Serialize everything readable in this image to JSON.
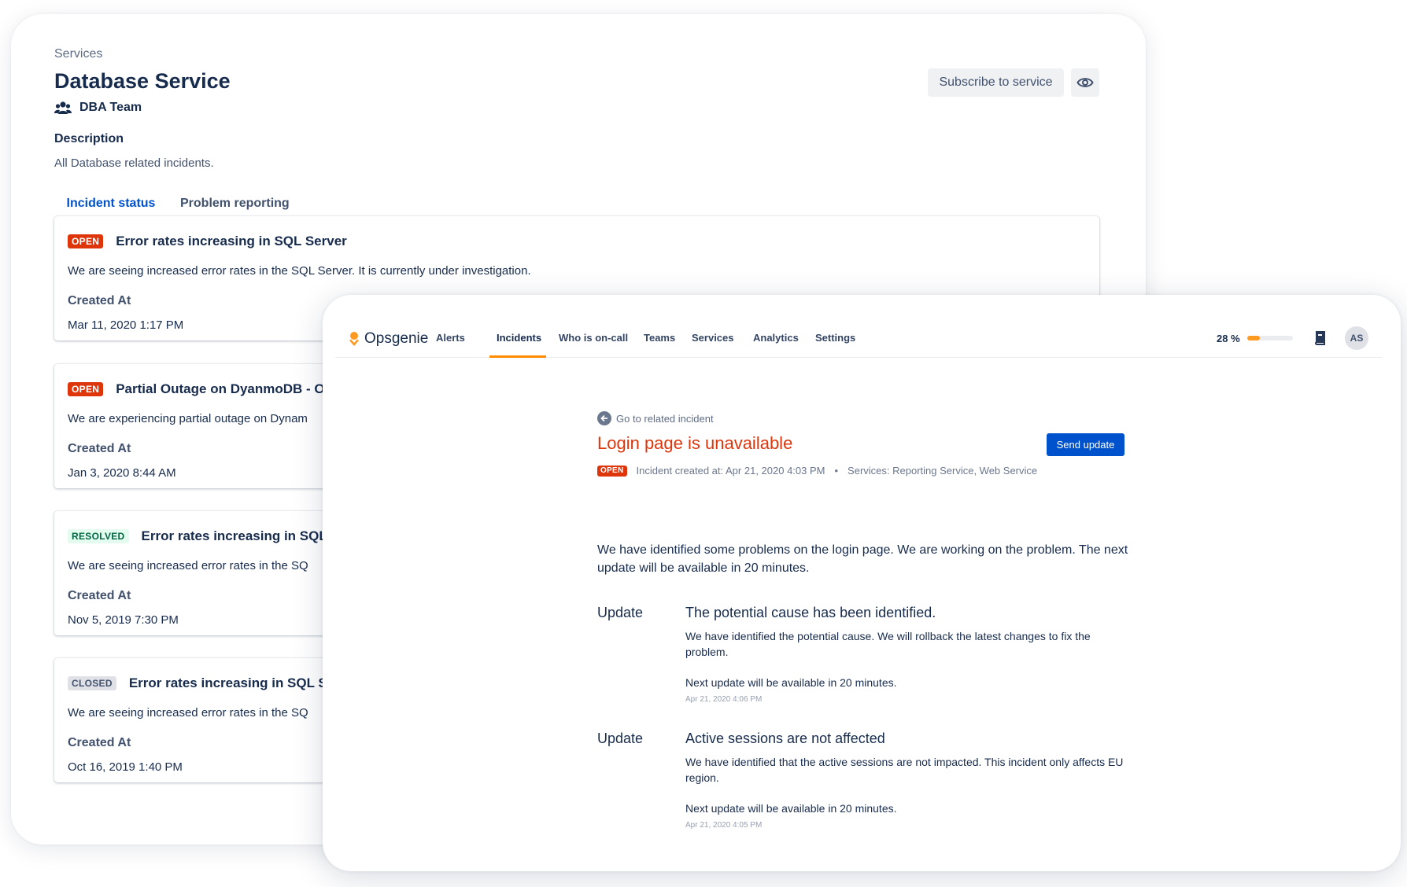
{
  "services_page": {
    "breadcrumb": "Services",
    "title": "Database Service",
    "team": "DBA Team",
    "description_label": "Description",
    "description_text": "All Database related incidents.",
    "subscribe_label": "Subscribe to service",
    "tabs": [
      {
        "label": "Incident status",
        "active": true
      },
      {
        "label": "Problem reporting",
        "active": false
      }
    ],
    "created_at_label": "Created At",
    "incidents": [
      {
        "status": "OPEN",
        "title": "Error rates increasing in SQL Server",
        "body": "We are seeing increased error rates in the SQL Server. It is currently under investigation.",
        "created_at": "Mar 11, 2020 1:17 PM"
      },
      {
        "status": "OPEN",
        "title": "Partial Outage on DyanmoDB - Oh",
        "body": "We are experiencing partial outage on Dynam",
        "created_at": "Jan 3, 2020 8:44 AM"
      },
      {
        "status": "RESOLVED",
        "title": "Error rates increasing in SQL S",
        "body": "We are seeing increased error rates in the SQ",
        "created_at": "Nov 5, 2019 7:30 PM"
      },
      {
        "status": "CLOSED",
        "title": "Error rates increasing in SQL Se",
        "body": "We are seeing increased error rates in the SQ",
        "created_at": "Oct 16, 2019 1:40 PM"
      }
    ]
  },
  "opsgenie": {
    "brand": "Opsgenie",
    "nav": [
      "Alerts",
      "Incidents",
      "Who is on-call",
      "Teams",
      "Services",
      "Analytics",
      "Settings"
    ],
    "active_nav": "Incidents",
    "progress_label": "28 %",
    "progress_fraction": 0.28,
    "avatar_initials": "AS",
    "back_link": "Go to related incident",
    "incident_title": "Login page is unavailable",
    "send_update_label": "Send update",
    "status": "OPEN",
    "created_text": "Incident created at: Apr 21, 2020 4:03 PM",
    "services_text": "Services: Reporting Service, Web Service",
    "separator": "•",
    "summary": "We have identified some problems on the login page. We are working on the problem. The next update will be available in 20 minutes.",
    "update_label": "Update",
    "updates": [
      {
        "title": "The potential cause has been identified.",
        "body": "We have identified the potential cause. We will rollback the latest changes to fix the problem.",
        "next": "Next update will be available in 20 minutes.",
        "time": "Apr 21, 2020 4:06 PM"
      },
      {
        "title": "Active sessions are not affected",
        "body": "We have identified that the active sessions are not impacted. This incident only affects EU region.",
        "next": "Next update will be available in 20 minutes.",
        "time": "Apr 21, 2020 4:05 PM"
      }
    ]
  },
  "colors": {
    "accent_blue": "#0052cc",
    "danger_red": "#de350b",
    "brand_orange": "#ff991f",
    "text_dark": "#172b4d"
  },
  "icons": {
    "team": "people-group-icon",
    "watch": "eye-icon",
    "back": "arrow-left-circle-icon",
    "logo": "opsgenie-logo-icon",
    "docs": "book-icon"
  }
}
